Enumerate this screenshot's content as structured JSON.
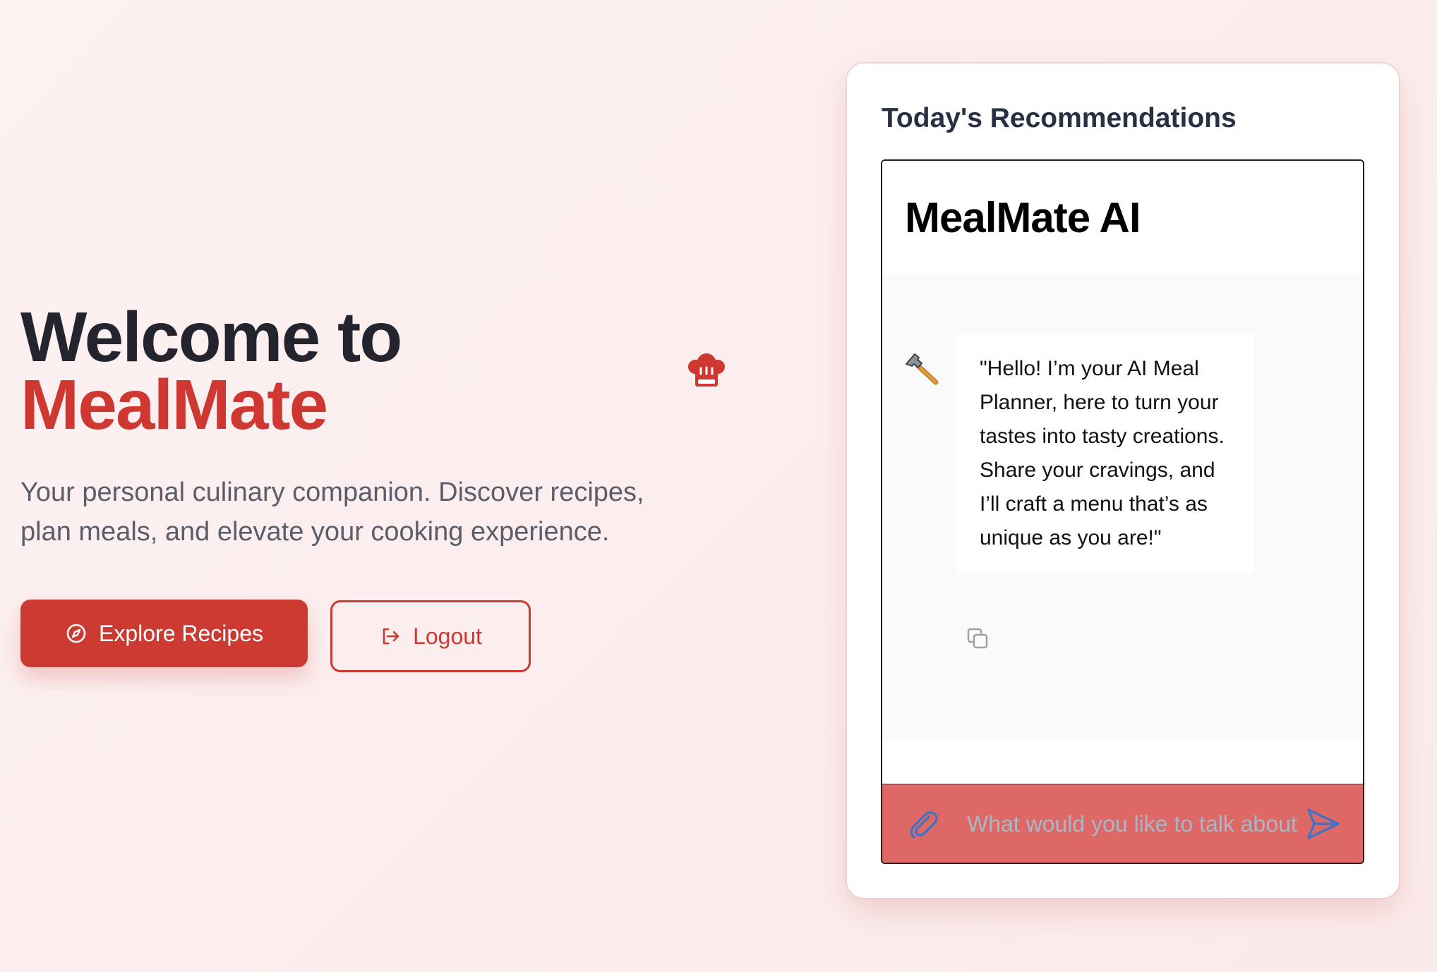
{
  "hero": {
    "title_line1": "Welcome to",
    "title_brand": "MealMate",
    "subtitle": "Your personal culinary companion. Discover recipes, plan meals, and elevate your cooking experience.",
    "icon": "chef-hat-icon"
  },
  "actions": {
    "explore_label": "Explore Recipes",
    "explore_icon": "compass-icon",
    "logout_label": "Logout",
    "logout_icon": "logout-icon"
  },
  "recommendations": {
    "title": "Today's Recommendations",
    "chat": {
      "title": "MealMate AI",
      "avatar": "hammer-icon",
      "message": "\"Hello! I’m your AI Meal Planner, here to turn your tastes into tasty creations. Share your cravings, and I’ll craft a menu that’s as unique as you are!\"",
      "copy_icon": "copy-icon",
      "input_placeholder": "What would you like to talk about",
      "attach_icon": "paperclip-icon",
      "send_icon": "send-icon"
    }
  },
  "colors": {
    "accent": "#cc3a32",
    "heading": "#23242e",
    "input_bar": "#dd6865",
    "link_icon": "#3b73c9"
  }
}
